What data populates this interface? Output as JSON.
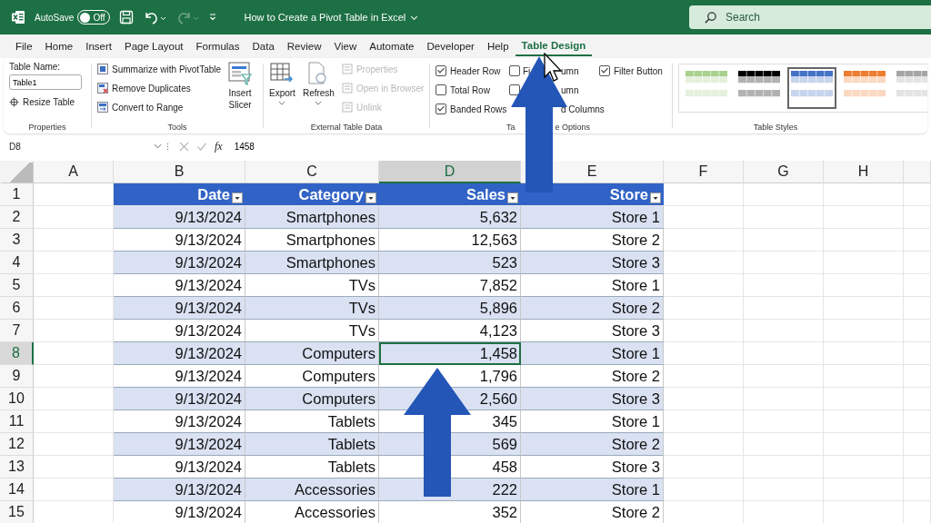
{
  "title_bar": {
    "autosave_label": "AutoSave",
    "autosave": {
      "on": false,
      "label": "Off"
    },
    "redo_disabled": true,
    "title": "How to Create a Pivot Table in Excel",
    "search": {
      "placeholder": "Search"
    }
  },
  "tabs": [
    {
      "label": "File",
      "selected": false
    },
    {
      "label": "Home",
      "selected": false
    },
    {
      "label": "Insert",
      "selected": false
    },
    {
      "label": "Page Layout",
      "selected": false
    },
    {
      "label": "Formulas",
      "selected": false
    },
    {
      "label": "Data",
      "selected": false
    },
    {
      "label": "Review",
      "selected": false
    },
    {
      "label": "View",
      "selected": false
    },
    {
      "label": "Automate",
      "selected": false
    },
    {
      "label": "Developer",
      "selected": false
    },
    {
      "label": "Help",
      "selected": false
    },
    {
      "label": "Table Design",
      "selected": true
    }
  ],
  "ribbon": {
    "properties": {
      "table_name_label": "Table Name:",
      "table_name": "Table1",
      "resize": "Resize Table",
      "label": "Properties"
    },
    "tools": {
      "items": [
        {
          "label": "Summarize with PivotTable"
        },
        {
          "label": "Remove Duplicates"
        },
        {
          "label": "Convert to Range"
        }
      ],
      "slicer": [
        "Insert",
        "Slicer"
      ],
      "label": "Tools"
    },
    "external": {
      "export": "Export",
      "refresh": "Refresh",
      "items": [
        {
          "label": "Properties",
          "disabled": true
        },
        {
          "label": "Open in Browser",
          "disabled": true
        },
        {
          "label": "Unlink",
          "disabled": true
        }
      ],
      "label": "External Table Data"
    },
    "style_options": {
      "column_1": [
        {
          "label": "Header Row",
          "checked": true
        },
        {
          "label": "Total Row",
          "checked": false
        },
        {
          "label": "Banded Rows",
          "checked": true
        }
      ],
      "column_2": [
        {
          "lead": "Fi",
          "tail": "umn",
          "checked": false
        },
        {
          "tail": "umn",
          "checked": false
        },
        {
          "tail": "d Columns"
        }
      ],
      "column_3": [
        {
          "label": "Filter Button",
          "checked": true
        }
      ],
      "label_lead": "Ta",
      "label_tail": "e Options"
    },
    "table_styles": {
      "styles": [
        {
          "color": "#a9d08e",
          "selected": false
        },
        {
          "color": "#000000",
          "selected": false
        },
        {
          "color": "#4472c4",
          "selected": true
        },
        {
          "color": "#ed7d31",
          "selected": false
        },
        {
          "color": "#a5a5a5",
          "selected": false
        }
      ],
      "label": "Table Styles"
    }
  },
  "formula_bar": {
    "name_box": "D8",
    "fx": "fx",
    "formula": "1458"
  },
  "sheet": {
    "columns": [
      {
        "label": "A",
        "selected": false
      },
      {
        "label": "B",
        "selected": false
      },
      {
        "label": "C",
        "selected": false
      },
      {
        "label": "D",
        "selected": true
      },
      {
        "label": "E",
        "selected": false
      },
      {
        "label": "F",
        "selected": false
      },
      {
        "label": "G",
        "selected": false
      },
      {
        "label": "H",
        "selected": false
      }
    ],
    "header_row": {
      "number": "1",
      "cells": [
        "",
        "Date",
        "Category",
        "Sales",
        "Store"
      ]
    },
    "rows": [
      {
        "number": "2",
        "selected": false,
        "cells": [
          "",
          "9/13/2024",
          "Smartphones",
          "5,632",
          "Store 1"
        ]
      },
      {
        "number": "3",
        "selected": false,
        "cells": [
          "",
          "9/13/2024",
          "Smartphones",
          "12,563",
          "Store 2"
        ]
      },
      {
        "number": "4",
        "selected": false,
        "cells": [
          "",
          "9/13/2024",
          "Smartphones",
          "523",
          "Store 3"
        ]
      },
      {
        "number": "5",
        "selected": false,
        "cells": [
          "",
          "9/13/2024",
          "TVs",
          "7,852",
          "Store 1"
        ]
      },
      {
        "number": "6",
        "selected": false,
        "cells": [
          "",
          "9/13/2024",
          "TVs",
          "5,896",
          "Store 2"
        ]
      },
      {
        "number": "7",
        "selected": false,
        "cells": [
          "",
          "9/13/2024",
          "TVs",
          "4,123",
          "Store 3"
        ]
      },
      {
        "number": "8",
        "selected": true,
        "cells": [
          "",
          "9/13/2024",
          "Computers",
          "1,458",
          "Store 1"
        ]
      },
      {
        "number": "9",
        "selected": false,
        "cells": [
          "",
          "9/13/2024",
          "Computers",
          "1,796",
          "Store 2"
        ]
      },
      {
        "number": "10",
        "selected": false,
        "cells": [
          "",
          "9/13/2024",
          "Computers",
          "2,560",
          "Store 3"
        ]
      },
      {
        "number": "11",
        "selected": false,
        "cells": [
          "",
          "9/13/2024",
          "Tablets",
          "345",
          "Store 1"
        ]
      },
      {
        "number": "12",
        "selected": false,
        "cells": [
          "",
          "9/13/2024",
          "Tablets",
          "569",
          "Store 2"
        ]
      },
      {
        "number": "13",
        "selected": false,
        "cells": [
          "",
          "9/13/2024",
          "Tablets",
          "458",
          "Store 3"
        ]
      },
      {
        "number": "14",
        "selected": false,
        "cells": [
          "",
          "9/13/2024",
          "Accessories",
          "222",
          "Store 1"
        ]
      },
      {
        "number": "15",
        "selected": false,
        "cells": [
          "",
          "9/13/2024",
          "Accessories",
          "352",
          "Store 2"
        ]
      }
    ]
  }
}
